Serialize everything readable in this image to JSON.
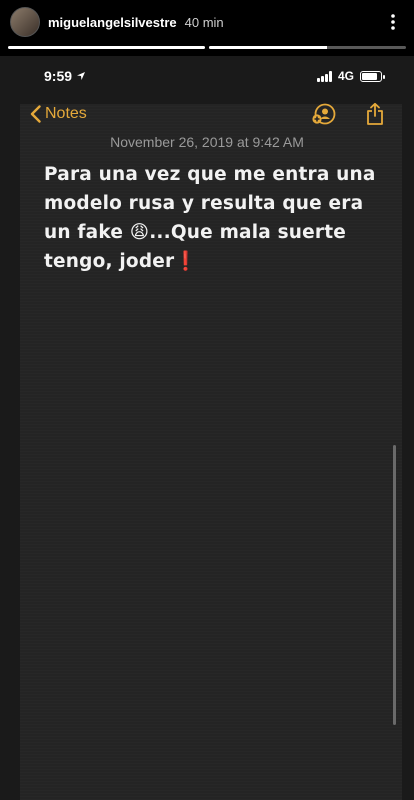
{
  "story": {
    "username": "miguelangelsilvestre",
    "time_ago": "40 min",
    "progress": [
      1.0,
      0.6
    ]
  },
  "status_bar": {
    "time": "9:59",
    "network": "4G"
  },
  "notes": {
    "back_label": "Notes",
    "date": "November 26, 2019 at 9:42 AM",
    "body": "Para una vez que me entra una modelo rusa  y resulta que era un fake 😩...Que mala suerte tengo, joder❗"
  },
  "icons": {
    "more": "more-icon",
    "back": "chevron-left-icon",
    "share_person": "add-person-icon",
    "share": "share-icon"
  },
  "colors": {
    "accent": "#e5a93a",
    "background": "#242424"
  }
}
